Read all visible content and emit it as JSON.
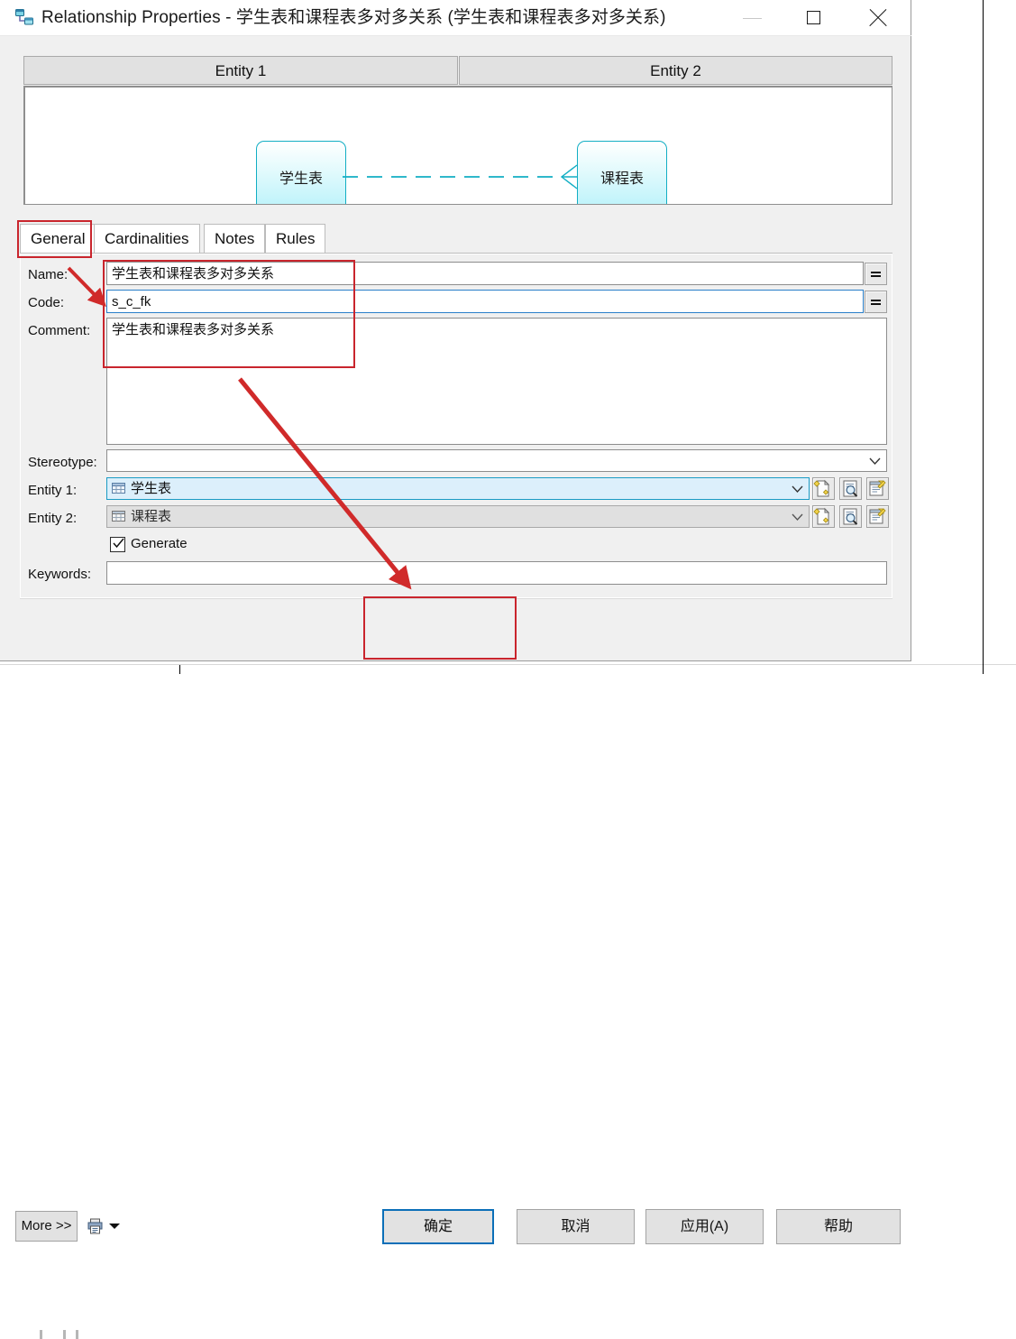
{
  "window": {
    "title": "Relationship Properties - 学生表和课程表多对多关系 (学生表和课程表多对多关系)",
    "icon": "relationship-icon",
    "controls": {
      "minimize": "minimize-icon",
      "maximize": "maximize-icon",
      "close": "close-icon"
    }
  },
  "preview": {
    "headers": [
      "Entity 1",
      "Entity 2"
    ],
    "entity1_label": "学生表",
    "entity2_label": "课程表",
    "link_style": "dashed-crowsfoot",
    "accent_color": "#12aec4"
  },
  "tabs": [
    {
      "label": "General",
      "selected": true
    },
    {
      "label": "Cardinalities",
      "selected": false
    },
    {
      "label": "Notes",
      "selected": false
    },
    {
      "label": "Rules",
      "selected": false
    }
  ],
  "form": {
    "name": {
      "label": "Name:",
      "value": "学生表和课程表多对多关系",
      "button": "equals-icon"
    },
    "code": {
      "label": "Code:",
      "value": "s_c_fk",
      "button": "equals-icon",
      "focused": true
    },
    "comment": {
      "label": "Comment:",
      "value": "学生表和课程表多对多关系"
    },
    "stereotype": {
      "label": "Stereotype:",
      "value": "",
      "placeholder": ""
    },
    "entity1": {
      "label": "Entity 1:",
      "value": "学生表",
      "selected": true,
      "buttons": [
        "create-icon",
        "properties-icon",
        "edit-icon"
      ]
    },
    "entity2": {
      "label": "Entity 2:",
      "value": "课程表",
      "selected": false,
      "buttons": [
        "create-icon",
        "properties-icon",
        "edit-icon"
      ]
    },
    "generate": {
      "label": "Generate",
      "checked": true
    },
    "keywords": {
      "label": "Keywords:",
      "value": ""
    }
  },
  "bottom": {
    "more": "More >>",
    "print_icon": "print-icon",
    "print_caret": "caret-down-icon",
    "ok": "确定",
    "cancel": "取消",
    "apply": "应用(A)",
    "help": "帮助"
  },
  "annotations": {
    "color": "#c9252d",
    "highlight_boxes": [
      "general-tab",
      "name-code-comment-fields",
      "ok-button"
    ],
    "arrows": [
      "name-to-code-field",
      "panel-to-ok-button"
    ]
  }
}
